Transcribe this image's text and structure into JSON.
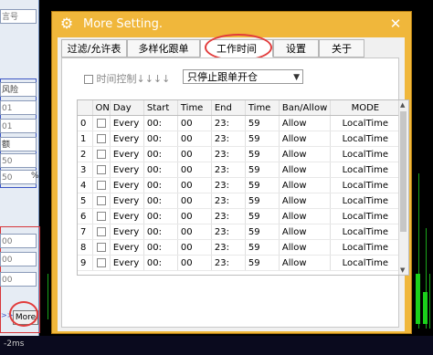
{
  "dialog": {
    "title": "More Setting.",
    "close": "✕",
    "tabs": [
      {
        "label": "过滤/允许表"
      },
      {
        "label": "多样化跟单"
      },
      {
        "label": "工作时间"
      },
      {
        "label": "设置"
      },
      {
        "label": "关于"
      }
    ],
    "active_tab": "工作时间",
    "time_control_label": "时间控制↓↓↓↓",
    "mode_select_value": "只停止跟单开仓",
    "columns": [
      "",
      "ON",
      "Day",
      "Start",
      "Time",
      "End",
      "Time",
      "Ban/Allow",
      "MODE"
    ],
    "rows": [
      {
        "idx": "0",
        "day": "Every",
        "start": "00:",
        "start_time": "00",
        "end": "23:",
        "end_time": "59",
        "ban": "Allow",
        "mode": "LocalTime"
      },
      {
        "idx": "1",
        "day": "Every",
        "start": "00:",
        "start_time": "00",
        "end": "23:",
        "end_time": "59",
        "ban": "Allow",
        "mode": "LocalTime"
      },
      {
        "idx": "2",
        "day": "Every",
        "start": "00:",
        "start_time": "00",
        "end": "23:",
        "end_time": "59",
        "ban": "Allow",
        "mode": "LocalTime"
      },
      {
        "idx": "3",
        "day": "Every",
        "start": "00:",
        "start_time": "00",
        "end": "23:",
        "end_time": "59",
        "ban": "Allow",
        "mode": "LocalTime"
      },
      {
        "idx": "4",
        "day": "Every",
        "start": "00:",
        "start_time": "00",
        "end": "23:",
        "end_time": "59",
        "ban": "Allow",
        "mode": "LocalTime"
      },
      {
        "idx": "5",
        "day": "Every",
        "start": "00:",
        "start_time": "00",
        "end": "23:",
        "end_time": "59",
        "ban": "Allow",
        "mode": "LocalTime"
      },
      {
        "idx": "6",
        "day": "Every",
        "start": "00:",
        "start_time": "00",
        "end": "23:",
        "end_time": "59",
        "ban": "Allow",
        "mode": "LocalTime"
      },
      {
        "idx": "7",
        "day": "Every",
        "start": "00:",
        "start_time": "00",
        "end": "23:",
        "end_time": "59",
        "ban": "Allow",
        "mode": "LocalTime"
      },
      {
        "idx": "8",
        "day": "Every",
        "start": "00:",
        "start_time": "00",
        "end": "23:",
        "end_time": "59",
        "ban": "Allow",
        "mode": "LocalTime"
      },
      {
        "idx": "9",
        "day": "Every",
        "start": "00:",
        "start_time": "00",
        "end": "23:",
        "end_time": "59",
        "ban": "Allow",
        "mode": "LocalTime"
      }
    ]
  },
  "left_panel": {
    "labels": [
      "言号",
      "风险",
      "01",
      "01",
      "额",
      "50",
      "50",
      "00",
      "00",
      "00"
    ],
    "more_label": "More",
    "arrows_label": ">>",
    "percent": "%"
  },
  "status": {
    "latency": "-2ms"
  },
  "colors": {
    "title_bar": "#f0b73b",
    "highlight": "#e23b3b",
    "chart_green": "#1bd11b"
  }
}
